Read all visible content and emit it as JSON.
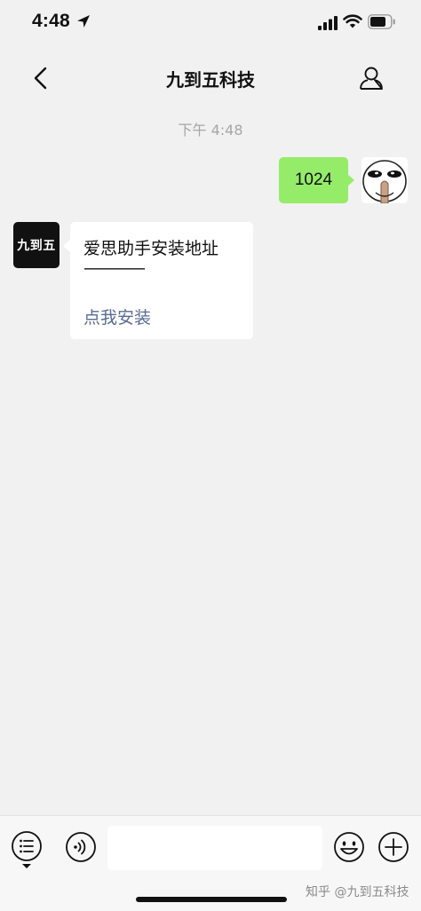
{
  "status_bar": {
    "time": "4:48"
  },
  "nav": {
    "title": "九到五科技"
  },
  "chat": {
    "timestamp": "下午 4:48",
    "sent": {
      "text": "1024"
    },
    "received": {
      "avatar_label": "九到五",
      "line1": "爱思助手安装地址",
      "line2": "————",
      "link": "点我安装"
    }
  },
  "input": {
    "value": "",
    "placeholder": ""
  },
  "watermark": "知乎 @九到五科技",
  "colors": {
    "sent_bubble": "#95ec69",
    "link": "#576b95",
    "background": "#f1f1f1"
  },
  "icons": {
    "back": "chevron-left-icon",
    "profile": "person-icon",
    "menu": "list-icon",
    "voice": "voice-icon",
    "emoji": "smiley-icon",
    "add": "plus-circle-icon"
  }
}
